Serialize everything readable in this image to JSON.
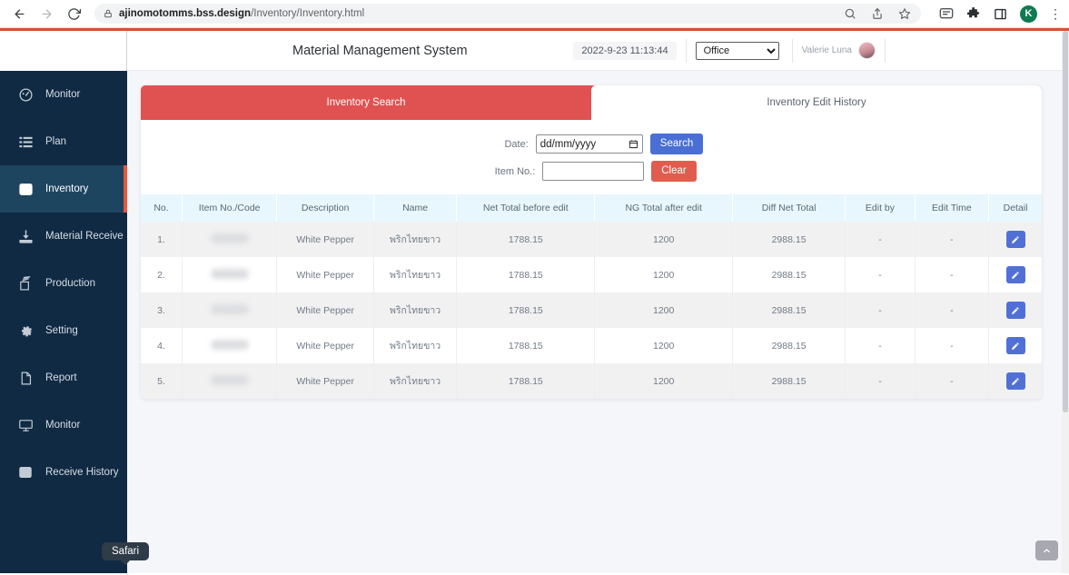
{
  "browser": {
    "back_icon": "back-arrow-icon",
    "forward_icon": "forward-arrow-icon",
    "reload_icon": "reload-icon",
    "url_domain": "ajinomotomms.bss.design",
    "url_path": "/Inventory/Inventory.html",
    "icons": [
      "search-icon",
      "share-icon",
      "bookmark-star-icon",
      "chat-icon",
      "extensions-puzzle-icon",
      "sidebar-panel-icon"
    ],
    "profile_initial": "K",
    "menu_icon": "three-dot-menu-icon"
  },
  "sidebar": {
    "items": [
      {
        "label": "Monitor",
        "icon": "dashboard-gauge-icon",
        "active": false
      },
      {
        "label": "Plan",
        "icon": "list-icon",
        "active": false
      },
      {
        "label": "Inventory",
        "icon": "inbox-icon",
        "active": true
      },
      {
        "label": "Material Receive",
        "icon": "download-tray-icon",
        "active": false
      },
      {
        "label": "Production",
        "icon": "stacked-layers-icon",
        "active": false
      },
      {
        "label": "Setting",
        "icon": "gear-icon",
        "active": false
      },
      {
        "label": "Report",
        "icon": "document-icon",
        "active": false
      },
      {
        "label": "Monitor",
        "icon": "desktop-monitor-icon",
        "active": false
      },
      {
        "label": "Receive History",
        "icon": "inbox-icon",
        "active": false
      }
    ]
  },
  "topbar": {
    "title": "Material Management System",
    "timestamp": "2022-9-23 11:13:44",
    "office_selected": "Office",
    "office_options": [
      "Office"
    ],
    "user_name": "Valerie Luna",
    "avatar": "user-avatar"
  },
  "tabs": [
    {
      "label": "Inventory Search",
      "active": false
    },
    {
      "label": "Inventory Edit History",
      "active": true
    }
  ],
  "search_form": {
    "date_label": "Date:",
    "date_value": "",
    "date_placeholder": "dd/mm/yyyy",
    "calendar_icon": "calendar-icon",
    "search_button": "Search",
    "item_label": "Item No.:",
    "item_value": "",
    "clear_button": "Clear"
  },
  "table": {
    "headers": [
      "No.",
      "Item No./Code",
      "Description",
      "Name",
      "Net Total before edit",
      "NG Total after edit",
      "Diff Net Total",
      "Edit by",
      "Edit Time",
      "Detail"
    ],
    "rows": [
      {
        "no": "1.",
        "item_code": "",
        "description": "White Pepper",
        "name": "พริกไทยขาว",
        "net_before": "1788.15",
        "ng_after": "1200",
        "diff_net": "2988.15",
        "edit_by": "-",
        "edit_time": "-",
        "detail_icon": "pencil-edit-icon"
      },
      {
        "no": "2.",
        "item_code": "",
        "description": "White Pepper",
        "name": "พริกไทยขาว",
        "net_before": "1788.15",
        "ng_after": "1200",
        "diff_net": "2988.15",
        "edit_by": "-",
        "edit_time": "-",
        "detail_icon": "pencil-edit-icon"
      },
      {
        "no": "3.",
        "item_code": "",
        "description": "White Pepper",
        "name": "พริกไทยขาว",
        "net_before": "1788.15",
        "ng_after": "1200",
        "diff_net": "2988.15",
        "edit_by": "-",
        "edit_time": "-",
        "detail_icon": "pencil-edit-icon"
      },
      {
        "no": "4.",
        "item_code": "",
        "description": "White Pepper",
        "name": "พริกไทยขาว",
        "net_before": "1788.15",
        "ng_after": "1200",
        "diff_net": "2988.15",
        "edit_by": "-",
        "edit_time": "-",
        "detail_icon": "pencil-edit-icon"
      },
      {
        "no": "5.",
        "item_code": "",
        "description": "White Pepper",
        "name": "พริกไทยขาว",
        "net_before": "1788.15",
        "ng_after": "1200",
        "diff_net": "2988.15",
        "edit_by": "-",
        "edit_time": "-",
        "detail_icon": "pencil-edit-icon"
      }
    ]
  },
  "tooltip": {
    "text": "Safari"
  },
  "scroll_top_button": {
    "icon": "chevron-up-icon"
  },
  "colors": {
    "sidebar": "#102a43",
    "sidebar_active": "#1e4560",
    "accent_red": "#e05252",
    "accent_bar": "#dd4b39",
    "primary_blue": "#4a6fd4",
    "clear_red": "#e05d4e",
    "table_header": "#e7f7fd"
  }
}
